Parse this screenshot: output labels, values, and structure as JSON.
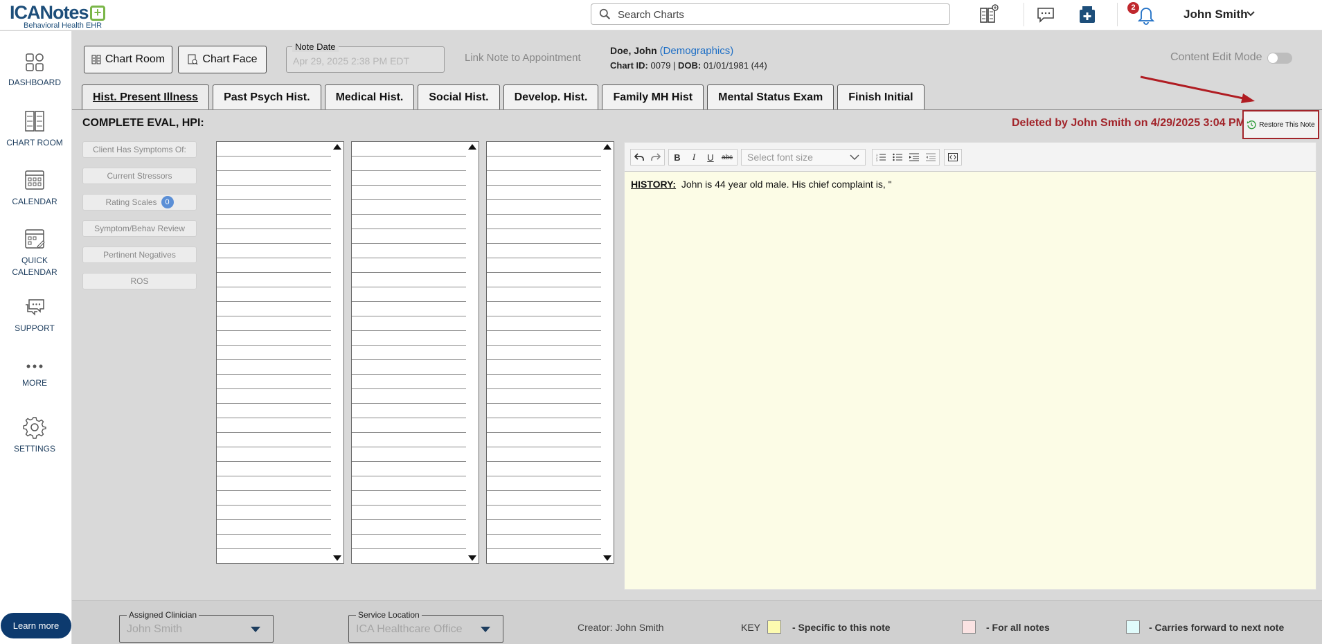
{
  "app": {
    "logo_main": "ICANotes",
    "logo_plus": "+",
    "logo_sub": "Behavioral Health EHR"
  },
  "search": {
    "placeholder": "Search Charts"
  },
  "notifications": {
    "count": "2"
  },
  "user": {
    "name": "John Smith"
  },
  "sidebar": {
    "items": [
      {
        "label": "DASHBOARD",
        "icon": "dashboard-icon"
      },
      {
        "label": "CHART ROOM",
        "icon": "chart-room-icon"
      },
      {
        "label": "CALENDAR",
        "icon": "calendar-icon"
      },
      {
        "label": "QUICK CALENDAR",
        "icon": "quick-calendar-icon"
      },
      {
        "label": "SUPPORT",
        "icon": "support-icon"
      },
      {
        "label": "MORE",
        "icon": "more-icon"
      },
      {
        "label": "SETTINGS",
        "icon": "gear-icon"
      }
    ],
    "learn_more": "Learn more"
  },
  "header": {
    "chart_room": "Chart Room",
    "chart_face": "Chart Face",
    "note_date_label": "Note Date",
    "note_date_value": "Apr 29, 2025 2:38 PM EDT",
    "link_appointment": "Link Note to Appointment",
    "patient_name": "Doe, John",
    "patient_demographics": "(Demographics)",
    "chart_id_label": "Chart ID:",
    "chart_id": "0079",
    "dob_label": "DOB:",
    "dob": "01/01/1981 (44)",
    "content_edit_mode": "Content Edit Mode"
  },
  "tabs": [
    {
      "label": "Hist. Present Illness",
      "active": true
    },
    {
      "label": "Past Psych Hist."
    },
    {
      "label": "Medical Hist."
    },
    {
      "label": "Social Hist."
    },
    {
      "label": "Develop. Hist."
    },
    {
      "label": "Family MH Hist"
    },
    {
      "label": "Mental Status Exam"
    },
    {
      "label": "Finish Initial"
    }
  ],
  "section": {
    "title": "COMPLETE EVAL, HPI:",
    "deleted_message": "Deleted by John Smith on 4/29/2025 3:04 PM",
    "restore_button": "Restore This Note"
  },
  "categories": [
    "Client Has Symptoms Of:",
    "Current Stressors",
    "Rating Scales",
    "Symptom/Behav Review",
    "Pertinent Negatives",
    "ROS"
  ],
  "rating_scales_count": "0",
  "editor": {
    "font_size_placeholder": "Select font size",
    "history_label": "HISTORY:",
    "body_text": "John is 44 year old male. His chief complaint is, \""
  },
  "footer": {
    "assigned_clinician_label": "Assigned Clinician",
    "assigned_clinician_value": "John Smith",
    "service_location_label": "Service Location",
    "service_location_value": "ICA Healthcare Office",
    "creator": "Creator: John Smith",
    "key_label": "KEY",
    "key_items": [
      {
        "text": "- Specific to this note",
        "color": "#fdfbb0"
      },
      {
        "text": "- For all notes",
        "color": "#fbe3e3"
      },
      {
        "text": "- Carries forward to next note",
        "color": "#e0fbfb"
      }
    ]
  },
  "colors": {
    "brand": "#1d4e7a",
    "deleted": "#a2242a",
    "link": "#1f6fc5",
    "editor_bg": "#fcfce6"
  }
}
